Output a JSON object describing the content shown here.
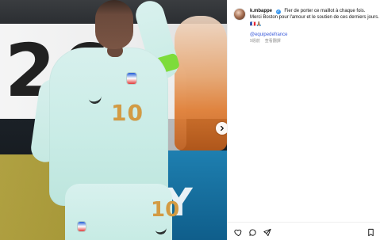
{
  "post": {
    "username": "k.mbappe",
    "caption_line1": "Fier de porter ce maillot à chaque fois.",
    "caption_line2": "Merci Boston pour l'amour et le soutien de ces derniers jours.",
    "emoji_line": "🇫🇷🙏🏽",
    "tag": "@equipedefrance",
    "time_ago": "9週前",
    "translate_label": "查看翻譯"
  },
  "media": {
    "background_banner_text": "26",
    "shirt_number": "10",
    "shorts_number": "10",
    "banner_right_text": "Y"
  },
  "ui": {
    "verified_glyph": "✓",
    "next_icon": "chevron-right-icon",
    "icons": {
      "like": "heart-icon",
      "comment": "comment-icon",
      "share": "send-icon",
      "save": "bookmark-icon"
    }
  }
}
